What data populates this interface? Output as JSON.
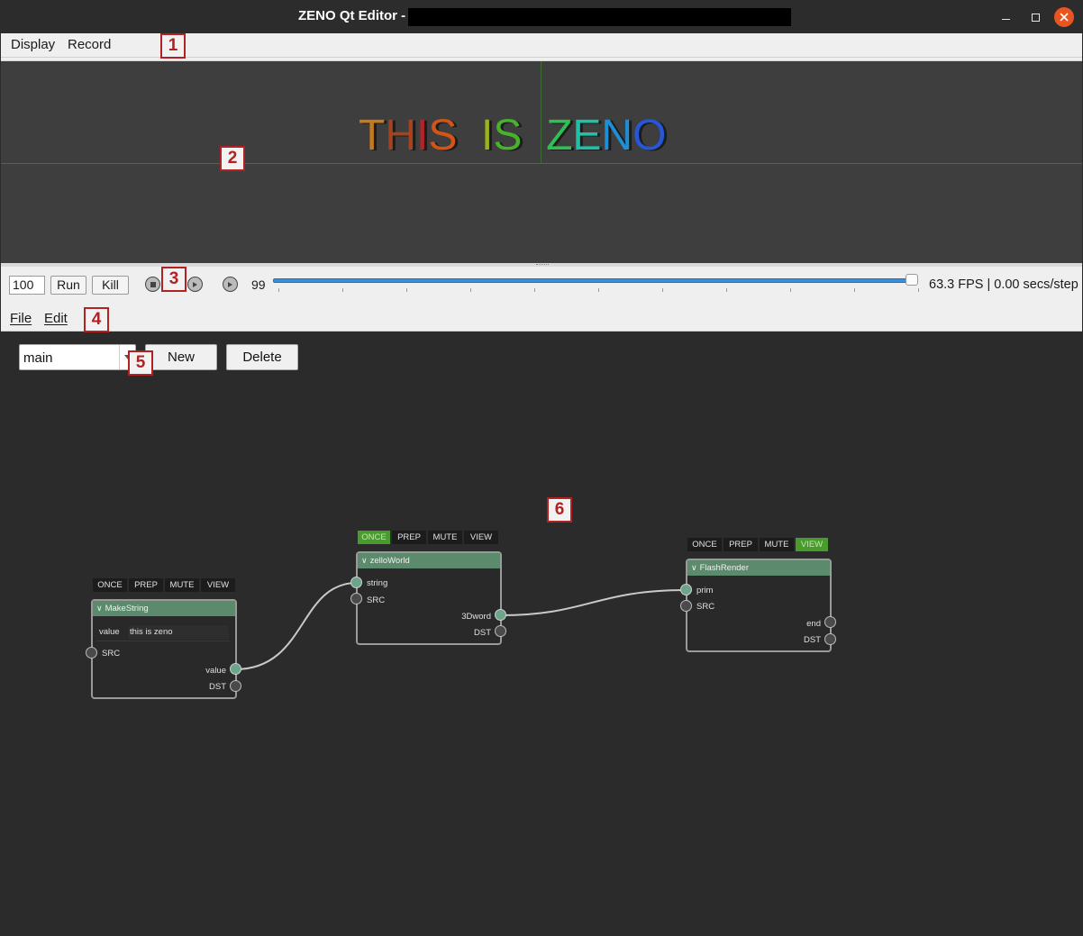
{
  "window": {
    "title": "ZENO Qt Editor -",
    "minimize_icon": "minimize-icon",
    "maximize_icon": "maximize-icon",
    "close_icon": "close-icon"
  },
  "top_menu": {
    "display": "Display",
    "record": "Record"
  },
  "viewport": {
    "scene_text": [
      "T",
      "H",
      "I",
      "S",
      " ",
      "I",
      "S",
      " ",
      "Z",
      "E",
      "N",
      "O"
    ],
    "scene_colors": [
      "#c57a1e",
      "#a6421f",
      "#b4232a",
      "#d45418",
      "#000000",
      "#9bb21c",
      "#48b32a",
      "#000000",
      "#2fbf55",
      "#1fc0a8",
      "#1e8fd4",
      "#2557d8"
    ]
  },
  "timeline": {
    "frame_count": "100",
    "run_label": "Run",
    "kill_label": "Kill",
    "current_frame": "99",
    "stats": "63.3 FPS | 0.00 secs/step",
    "progress": 0.99
  },
  "bottom_menu": {
    "file": "File",
    "edit": "Edit"
  },
  "graph": {
    "subgraph_selected": "main",
    "new_label": "New",
    "delete_label": "Delete",
    "option_labels": [
      "ONCE",
      "PREP",
      "MUTE",
      "VIEW"
    ],
    "nodes": {
      "makestring": {
        "title": "MakeString",
        "param_name": "value",
        "param_value": "this is zeno",
        "input_src": "SRC",
        "output_value": "value",
        "output_dst": "DST"
      },
      "zelloworld": {
        "title": "zelloWorld",
        "input_string": "string",
        "input_src": "SRC",
        "output_3dword": "3Dword",
        "output_dst": "DST"
      },
      "flashrender": {
        "title": "FlashRender",
        "input_prim": "prim",
        "input_src": "SRC",
        "output_end": "end",
        "output_dst": "DST"
      }
    }
  },
  "annotations": [
    "1",
    "2",
    "3",
    "4",
    "5",
    "6"
  ]
}
